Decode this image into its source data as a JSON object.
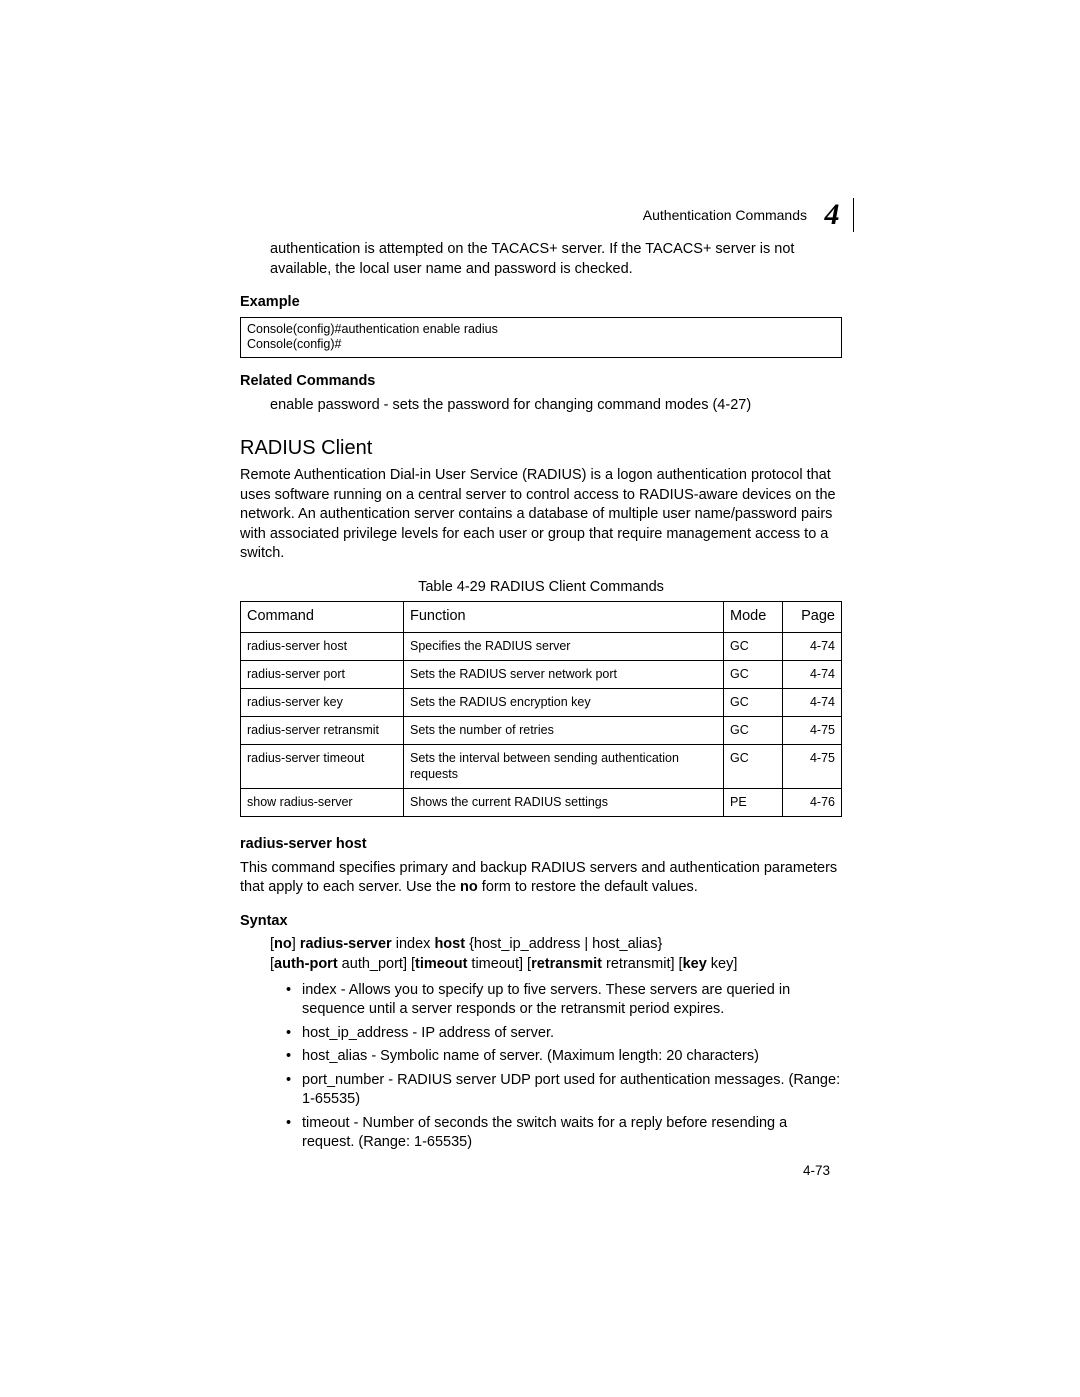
{
  "header": {
    "title": "Authentication Commands",
    "chapter": "4"
  },
  "intro_paragraph": "authentication is attempted on the TACACS+ server. If the TACACS+ server is not available, the local user name and password is checked.",
  "example_heading": "Example",
  "example_box": "Console(config)#authentication enable radius\nConsole(config)#",
  "related_commands_heading": "Related Commands",
  "related_commands_text": "enable password -  sets the password for changing command modes (4-27)",
  "section_title": "RADIUS Client",
  "section_text": "Remote Authentication Dial-in User Service (RADIUS) is a logon authentication protocol that uses software running on a central server to control access to RADIUS-aware devices on the network. An authentication server contains a database of multiple user name/password pairs with associated privilege levels for each user or group that require management access to a switch.",
  "table_caption": "Table 4-29  RADIUS Client Commands",
  "table": {
    "headers": [
      "Command",
      "Function",
      "Mode",
      "Page"
    ],
    "rows": [
      {
        "command": "radius-server host",
        "function": "Specifies the RADIUS server",
        "mode": "GC",
        "page": "4-74"
      },
      {
        "command": "radius-server port",
        "function": "Sets the RADIUS server network port",
        "mode": "GC",
        "page": "4-74"
      },
      {
        "command": "radius-server key",
        "function": "Sets the RADIUS encryption key",
        "mode": "GC",
        "page": "4-74"
      },
      {
        "command": "radius-server retransmit",
        "function": "Sets the number of retries",
        "mode": "GC",
        "page": "4-75"
      },
      {
        "command": "radius-server timeout",
        "function": "Sets the interval between sending authentication requests",
        "mode": "GC",
        "page": "4-75"
      },
      {
        "command": "show radius-server",
        "function": "Shows the current RADIUS settings",
        "mode": "PE",
        "page": "4-76"
      }
    ]
  },
  "command_heading": "radius-server host",
  "command_text_before_bold": "This command specifies primary and backup RADIUS servers and authentication parameters that apply to each server. Use the ",
  "command_text_bold": "no",
  "command_text_after_bold": " form to restore the default values.",
  "syntax_heading": "Syntax",
  "syntax": {
    "line1": {
      "p1": "[",
      "b1": "no",
      "p2": "] ",
      "b2": "radius-server",
      "p3": " index ",
      "b3": "host",
      "p4": " {host_ip_address | host_alias}"
    },
    "line2": {
      "p1": "[",
      "b1": "auth-port",
      "p2": " auth_port] [",
      "b2": "timeout",
      "p3": " timeout] [",
      "b3": "retransmit",
      "p4": " retransmit] [",
      "b4": "key",
      "p5": " key]"
    },
    "bullets": [
      "index - Allows you to specify up to five servers. These servers are queried in sequence until a server responds or the retransmit period expires.",
      "host_ip_address - IP address of server.",
      "host_alias - Symbolic name of server. (Maximum length: 20 characters)",
      "port_number - RADIUS server UDP port used for authentication messages. (Range: 1-65535)",
      "timeout - Number of seconds the switch waits for a reply before resending a request. (Range: 1-65535)"
    ]
  },
  "page_number": "4-73"
}
